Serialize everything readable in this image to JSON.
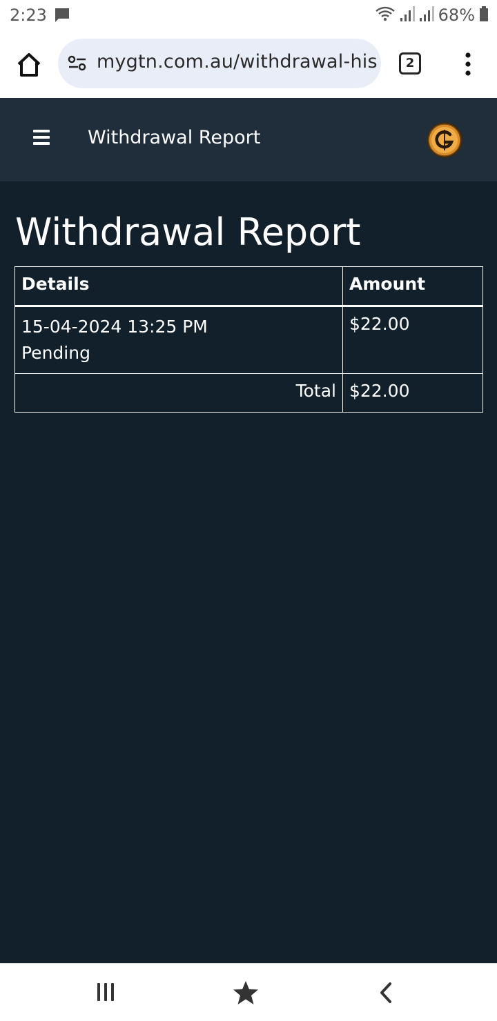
{
  "status_bar": {
    "time": "2:23",
    "battery": "68%",
    "icons": [
      "message-icon",
      "wifi-icon",
      "signal-icon",
      "signal-icon",
      "battery-icon"
    ]
  },
  "browser": {
    "url": "mygtn.com.au/withdrawal-his",
    "tab_count": "2",
    "icons": [
      "home-icon",
      "site-settings-icon",
      "more-vert-icon"
    ]
  },
  "header": {
    "title": "Withdrawal Report",
    "icons": [
      "hamburger-icon",
      "gtn-logo"
    ]
  },
  "main": {
    "page_title": "Withdrawal Report",
    "table": {
      "headers": [
        "Details",
        "Amount"
      ],
      "rows": [
        {
          "datetime": "15-04-2024 13:25 PM",
          "status": "Pending",
          "amount": "$22.00"
        }
      ],
      "total_label": "Total",
      "total_amount": "$22.00"
    }
  },
  "bottom_nav": {
    "icons": [
      "recents-icon",
      "home-star-icon",
      "back-icon"
    ]
  },
  "colors": {
    "header_bg": "#1f2e3a",
    "main_bg": "#11202b",
    "url_pill_bg": "#e9edf7",
    "logo_gold": "#e8a33a"
  }
}
